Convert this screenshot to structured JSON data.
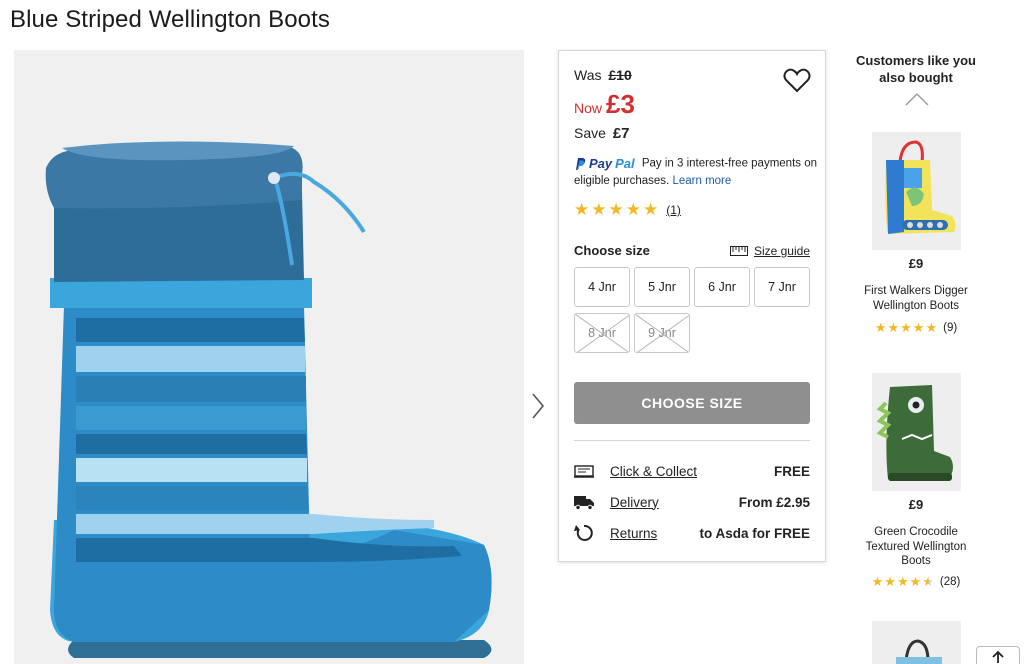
{
  "product": {
    "title": "Blue Striped Wellington Boots"
  },
  "pricing": {
    "was_label": "Was",
    "was_amount": "£10",
    "now_label": "Now",
    "now_amount": "£3",
    "save_label": "Save",
    "save_amount": "£7",
    "price_color": "#d32f2f"
  },
  "paypal": {
    "logo_p": "Pay",
    "logo_pal": "Pal",
    "text": "Pay in 3 interest-free payments on eligible purchases.",
    "learn_more": "Learn more"
  },
  "rating": {
    "stars": 5,
    "count": "(1)"
  },
  "sizes": {
    "heading": "Choose size",
    "guide_label": "Size guide",
    "options": [
      {
        "label": "4 Jnr",
        "available": true
      },
      {
        "label": "5 Jnr",
        "available": true
      },
      {
        "label": "6 Jnr",
        "available": true
      },
      {
        "label": "7 Jnr",
        "available": true
      },
      {
        "label": "8 Jnr",
        "available": false
      },
      {
        "label": "9 Jnr",
        "available": false
      }
    ]
  },
  "cta": {
    "label": "CHOOSE SIZE"
  },
  "delivery": [
    {
      "icon": "click-collect-icon",
      "label": "Click & Collect",
      "value": "FREE"
    },
    {
      "icon": "truck-icon",
      "label": "Delivery",
      "value": "From £2.95"
    },
    {
      "icon": "returns-icon",
      "label": "Returns",
      "value": "to Asda for FREE"
    }
  ],
  "recommendations": {
    "title": "Customers like you also bought",
    "items": [
      {
        "price": "£9",
        "name": "First Walkers Digger Wellington Boots",
        "rating": 5,
        "count": "(9)"
      },
      {
        "price": "£9",
        "name": "Green Crocodile Textured Wellington Boots",
        "rating": 4.5,
        "count": "(28)"
      }
    ]
  },
  "colors": {
    "accent_red": "#d32f2f",
    "cta_grey": "#8f8f8f",
    "star_gold": "#f2b826",
    "link_blue": "#1f5aa8"
  }
}
